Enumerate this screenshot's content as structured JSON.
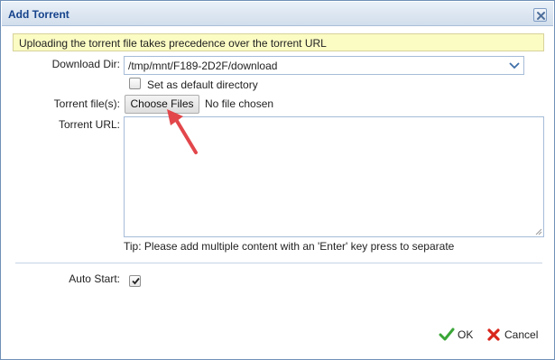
{
  "dialog": {
    "title": "Add Torrent",
    "close_icon": "close-icon",
    "notice": "Uploading the torrent file takes precedence over the torrent URL"
  },
  "form": {
    "download_dir_label": "Download Dir:",
    "download_dir_value": "/tmp/mnt/F189-2D2F/download",
    "default_dir_label": "Set as default directory",
    "default_dir_checked": false,
    "torrent_file_label": "Torrent file(s):",
    "choose_files_label": "Choose Files",
    "no_file_text": "No file chosen",
    "torrent_url_label": "Torrent URL:",
    "torrent_url_value": "",
    "tip": "Tip: Please add multiple content with an 'Enter' key press to separate",
    "auto_start_label": "Auto Start:",
    "auto_start_checked": true
  },
  "footer": {
    "ok_label": "OK",
    "cancel_label": "Cancel"
  },
  "colors": {
    "title_text": "#15428b",
    "notice_bg": "#fbfbc4",
    "ok_icon": "#3aa637",
    "cancel_icon": "#d9261c",
    "annotation_arrow": "#e2474b"
  }
}
